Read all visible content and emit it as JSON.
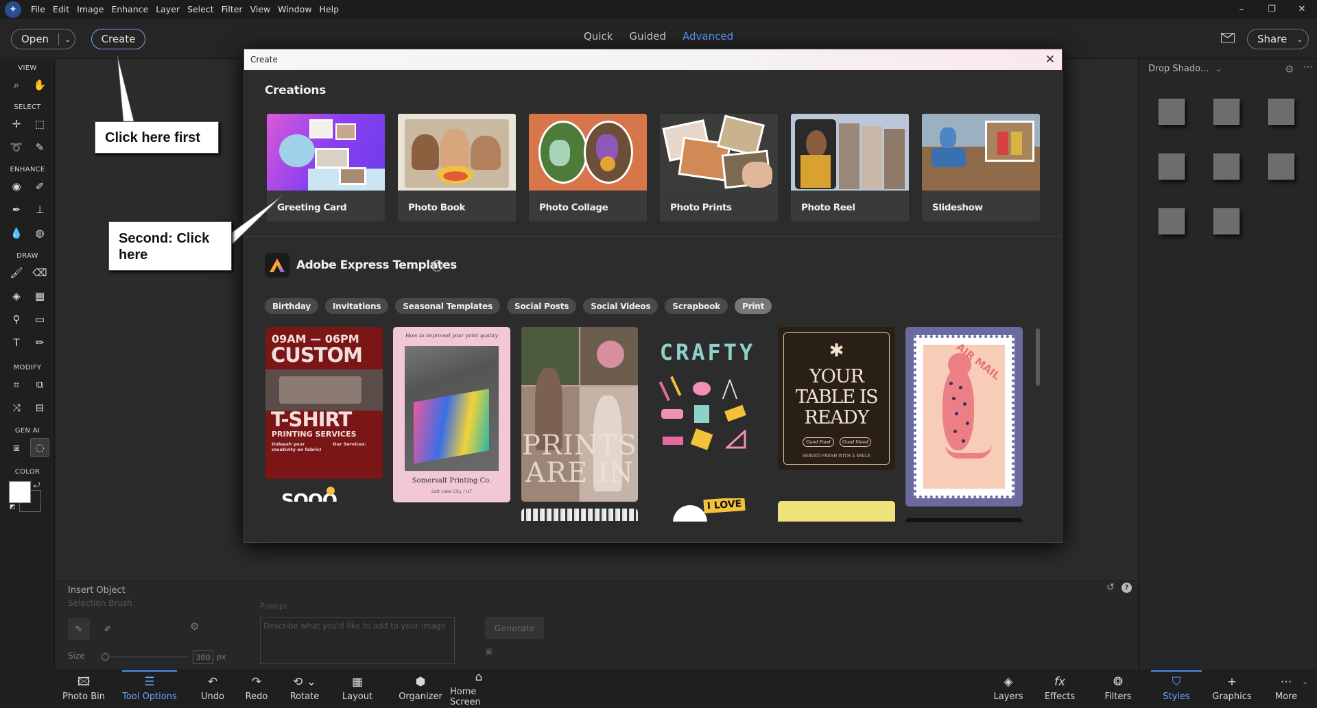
{
  "menubar": {
    "items": [
      "File",
      "Edit",
      "Image",
      "Enhance",
      "Layer",
      "Select",
      "Filter",
      "View",
      "Window",
      "Help"
    ],
    "controls": {
      "minimize": "–",
      "restore": "❐",
      "close": "✕"
    }
  },
  "topbar": {
    "open_label": "Open",
    "create_label": "Create",
    "modes": [
      "Quick",
      "Guided",
      "Advanced"
    ],
    "active_mode": "Advanced",
    "share_label": "Share"
  },
  "toolbox": {
    "sections": {
      "view": "VIEW",
      "select": "SELECT",
      "enhance": "ENHANCE",
      "draw": "DRAW",
      "modify": "MODIFY",
      "gen_ai": "GEN AI",
      "color": "COLOR"
    }
  },
  "dialog": {
    "title": "Create",
    "creations_title": "Creations",
    "creations": [
      {
        "label": "Greeting Card",
        "icon": "greeting-card-thumbnail"
      },
      {
        "label": "Photo Book",
        "icon": "photo-book-thumbnail"
      },
      {
        "label": "Photo Collage",
        "icon": "photo-collage-thumbnail"
      },
      {
        "label": "Photo Prints",
        "icon": "photo-prints-thumbnail"
      },
      {
        "label": "Photo Reel",
        "icon": "photo-reel-thumbnail"
      },
      {
        "label": "Slideshow",
        "icon": "slideshow-thumbnail"
      }
    ],
    "express_title": "Adobe Express Templates",
    "chips": [
      "Birthday",
      "Invitations",
      "Seasonal Templates",
      "Social Posts",
      "Social Videos",
      "Scrapbook",
      "Print"
    ],
    "active_chip": "Print",
    "templates": {
      "t1": {
        "line1": "09AM — 06PM",
        "line2": "CUSTOM",
        "line3": "T-SHIRT",
        "line4": "PRINTING SERVICES",
        "line5": "Unleash your creativity on fabric!",
        "line6": "Our Services:"
      },
      "t2": {
        "line1": "How to improved your print quality",
        "line2": "Somersalt Printing Co.",
        "line3": "Salt Lake City / UT"
      },
      "t3": {
        "line1": "PRINTS",
        "line2": "ARE IN"
      },
      "t4": {
        "line1": "CRAFTY"
      },
      "t5": {
        "line1": "YOUR",
        "line2": "TABLE IS",
        "line3": "READY",
        "line4": "Good Food",
        "line5": "Good Mood",
        "line6": "SERVED FRESH WITH A SMILE"
      },
      "t6": {
        "line1": "AIR MAIL"
      },
      "t7": {
        "line1": "I LOVE"
      },
      "t8": {
        "line1": "SOOO"
      }
    }
  },
  "right_panel": {
    "header": "Drop Shado...",
    "swatch_count": 8
  },
  "insert_panel": {
    "title": "Insert Object",
    "selection_brush": "Selection Brush",
    "prompt_label": "Prompt",
    "prompt_placeholder": "Describe what you'd like to add to your image",
    "generate_label": "Generate",
    "size_label": "Size",
    "size_value": "300",
    "size_unit": "px"
  },
  "bottombar": {
    "left": [
      "Photo Bin",
      "Tool Options",
      "Undo",
      "Redo",
      "Rotate",
      "Layout",
      "Organizer",
      "Home Screen"
    ],
    "right": [
      "Layers",
      "Effects",
      "Filters",
      "Styles",
      "Graphics",
      "More"
    ],
    "active_left": "Tool Options",
    "active_right": "Styles"
  },
  "callouts": {
    "first": "Click here first",
    "second": "Second: Click here"
  },
  "colors": {
    "accent": "#5b9bff",
    "foreground": "#ffffff",
    "background": "#000000"
  }
}
